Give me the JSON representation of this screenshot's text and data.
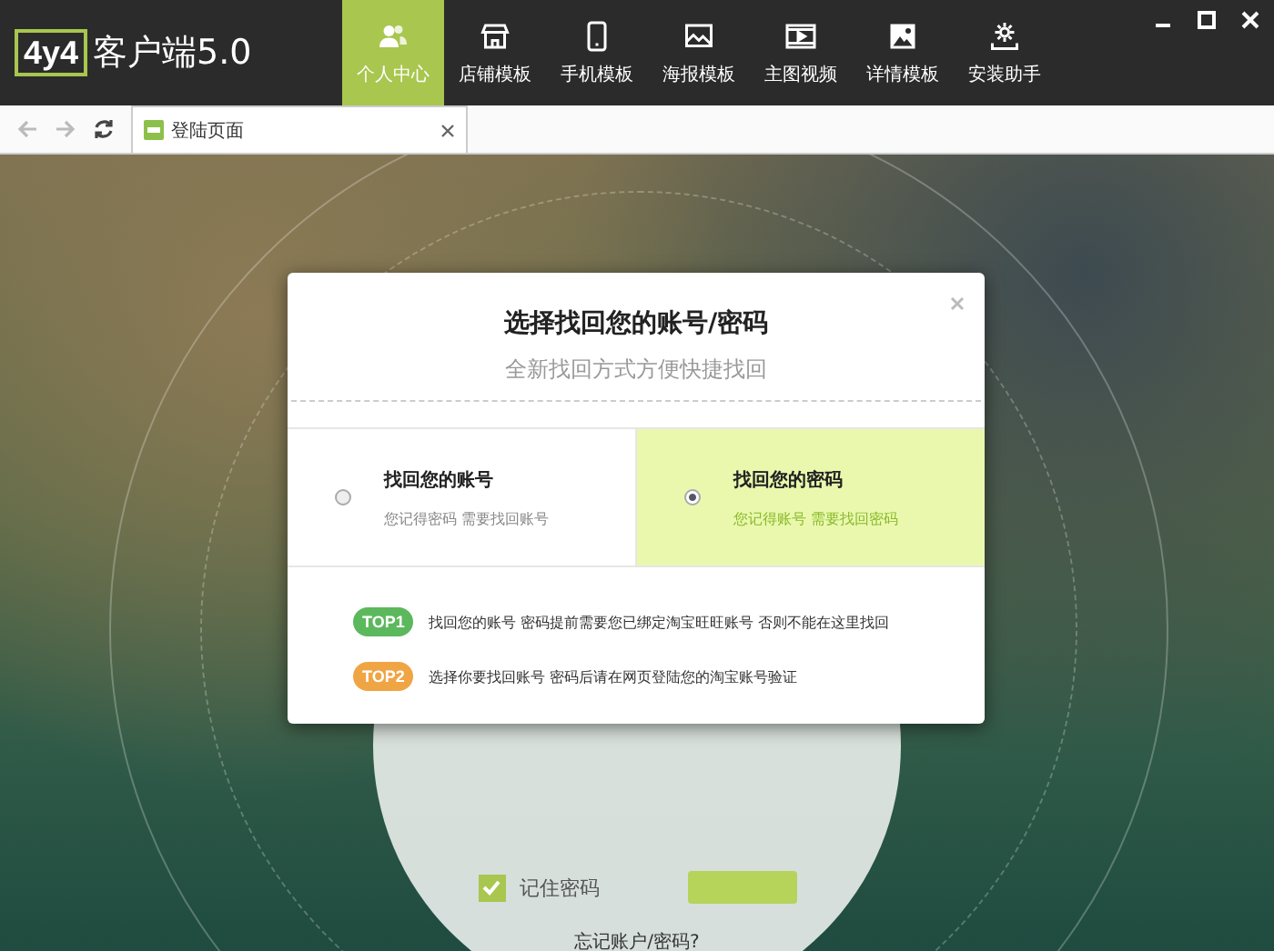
{
  "app": {
    "logo_badge": "4y4",
    "logo_text": "客户端5.0"
  },
  "nav": [
    {
      "label": "个人中心",
      "kind": "people",
      "selected": true
    },
    {
      "label": "店铺模板",
      "kind": "store",
      "selected": false
    },
    {
      "label": "手机模板",
      "kind": "phone",
      "selected": false
    },
    {
      "label": "海报模板",
      "kind": "poster",
      "selected": false
    },
    {
      "label": "主图视频",
      "kind": "video",
      "selected": false
    },
    {
      "label": "详情模板",
      "kind": "image",
      "selected": false
    },
    {
      "label": "安装助手",
      "kind": "gear",
      "selected": false
    }
  ],
  "browser_tabs": [
    {
      "label": "登陆页面",
      "selected": true
    }
  ],
  "login": {
    "remember_label": "记住密码",
    "remember_checked": true,
    "forgot_link": "忘记账户/密码?"
  },
  "dialog": {
    "title": "选择找回您的账号/密码",
    "subtitle": "全新找回方式方便快捷找回",
    "options": [
      {
        "title": "找回您的账号",
        "description": "您记得密码 需要找回账号",
        "selected": false
      },
      {
        "title": "找回您的密码",
        "description": "您记得账号 需要找回密码",
        "selected": true
      }
    ],
    "tips": [
      {
        "badge": "TOP1",
        "text": "找回您的账号 密码提前需要您已绑定淘宝旺旺账号 否则不能在这里找回",
        "color": "#5cb85c"
      },
      {
        "badge": "TOP2",
        "text": "选择你要找回账号 密码后请在网页登陆您的淘宝账号验证",
        "color": "#f0a545"
      }
    ]
  }
}
